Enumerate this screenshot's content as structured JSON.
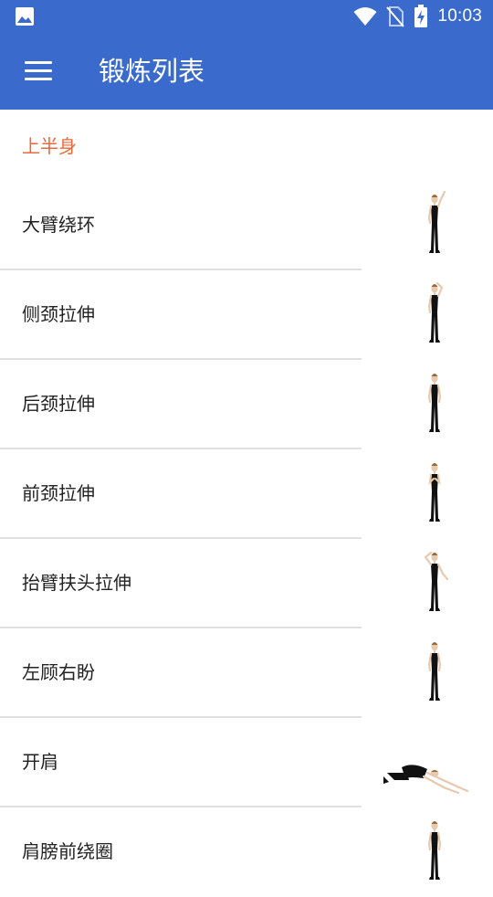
{
  "status_bar": {
    "time": "10:03",
    "left_icon": "image-icon",
    "icons": [
      "wifi-icon",
      "no-sim-icon",
      "battery-charging-icon"
    ]
  },
  "toolbar": {
    "menu_icon": "menu-icon",
    "title": "锻炼列表"
  },
  "section": {
    "title": "上半身"
  },
  "exercises": [
    {
      "label": "大臂绕环",
      "pose": "arm-raised"
    },
    {
      "label": "侧颈拉伸",
      "pose": "hand-on-head"
    },
    {
      "label": "后颈拉伸",
      "pose": "standing"
    },
    {
      "label": "前颈拉伸",
      "pose": "hands-chest"
    },
    {
      "label": "抬臂扶头拉伸",
      "pose": "hand-on-head-arm-out"
    },
    {
      "label": "左顾右盼",
      "pose": "standing"
    },
    {
      "label": "开肩",
      "pose": "kneeling-reach"
    },
    {
      "label": "肩膀前绕圈",
      "pose": "standing"
    }
  ],
  "colors": {
    "app_bar": "#3a6bcc",
    "section_accent": "#e8693b",
    "text": "#222222",
    "divider": "#e0e0e0"
  }
}
